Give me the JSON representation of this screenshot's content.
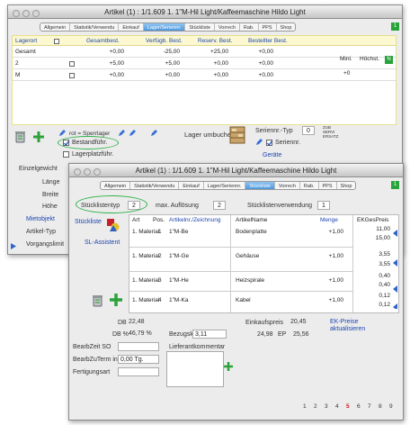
{
  "win1": {
    "title": "Artikel (1) : 1/1.609 1. 1\"M-Hil Light/Kaffeemaschine Hildo Light",
    "tabs": [
      "Allgemein",
      "Statistik/Verwendu",
      "Einkauf",
      "Lager/Seriennr.",
      "Stückliste",
      "Vorrech",
      "Rab.",
      "PPS",
      "Shop"
    ],
    "active_tab": 3,
    "badge": "1",
    "columns": [
      "Lagerort",
      "Gesamtbest.",
      "Verfügb. Best.",
      "Reserv. Best.",
      "Bestellter Best."
    ],
    "rows": [
      {
        "name": "Gesamt",
        "v1": "+0,00",
        "v2": "-25,00",
        "v3": "+25,00",
        "v4": "+0,00"
      },
      {
        "name": "2",
        "v1": "+5,00",
        "v2": "+5,00",
        "v3": "+0,00",
        "v4": "+0,00"
      },
      {
        "name": "M",
        "v1": "+0,00",
        "v2": "+0,00",
        "v3": "+0,00",
        "v4": "+0,00"
      }
    ],
    "extra_cols": [
      "Minl.",
      "Höchst."
    ],
    "badge_n": "N",
    "rot_sperrlager": "rot = Sperrlager",
    "bestandfuhr": "Bestandführ.",
    "lagerplatzfuhr": "Lagerplatzführ.",
    "lager_umbuchen": "Lager umbuchen",
    "seriennr_typ": "Seriennr.-Typ",
    "typ_value": "0",
    "serienn": "Seriennr.",
    "gerate": "Geräte",
    "tags": "ZUB SERVI ERSATZ",
    "side_labels": [
      "Einzelgewicht",
      "Länge",
      "Breite",
      "Höhe",
      "Mietobjekt",
      "Artikel-Typ",
      "Vorgangslimit"
    ]
  },
  "win2": {
    "title": "Artikel (1) : 1/1.609 1. 1\"M-Hil Light/Kaffeemaschine Hildo Light",
    "tabs": [
      "Allgemein",
      "Statistik/Verwendu",
      "Einkauf",
      "Lager/Seriennr.",
      "Stückliste",
      "Vorrech",
      "Rab.",
      "PPS",
      "Shop"
    ],
    "active_tab": 4,
    "badge": "1",
    "stucklistentyp": "Stücklistentyp",
    "typ_value": "2",
    "max_aufl": "max. Auflösung",
    "max_value": "2",
    "stucklistenverw": "Stücklistenverwendung",
    "verw_value": "1",
    "stuckliste": "Stückliste",
    "sl_assistent": "SL-Assistent",
    "columns": [
      "Art",
      "Pos.",
      "Artikelnr./Zeichnung",
      "ArtikelName",
      "Menge",
      "EKGesPreis"
    ],
    "rows": [
      {
        "art": "1. Material",
        "pos": "1",
        "nr": "1\"M-Be",
        "name": "Bodenplatte",
        "menge": "+1,00",
        "preis": "15,00"
      },
      {
        "art": "1. Material",
        "pos": "2",
        "nr": "1\"M-Ge",
        "name": "Gehäuse",
        "menge": "+1,00",
        "preis": "3,55"
      },
      {
        "art": "1. Material",
        "pos": "3",
        "nr": "1\"M-He",
        "name": "Heizspirale",
        "menge": "+1,00",
        "preis": "0,40"
      },
      {
        "art": "1. Material",
        "pos": "4",
        "nr": "1\"M-Ka",
        "name": "Kabel",
        "menge": "+1,00",
        "preis": "0,12"
      }
    ],
    "subtotals": [
      "11,00",
      "15,00",
      "3,55",
      "0,40",
      "0,12",
      "0,12"
    ],
    "db_label": "DB",
    "db_value": "22,48",
    "dbpct_label": "DB %",
    "dbpct_value": "46,79 %",
    "ek_label": "Einkaufspreis",
    "ek_value": "20,45",
    "ek_link": "EK-Preise aktualisieren",
    "bezug_label": "Bezugskosten",
    "bezug_value": "3,11",
    "p1": "24,98",
    "ep_label": "EP",
    "ep_value": "25,56",
    "bearb_label": "BearbZeit SO",
    "lief_label": "Lieferantkommentar",
    "bearbz_label": "BearbZuTerm in",
    "bearbz_value": "0,00 Tg.",
    "fert_label": "Fertigungsart",
    "pages": [
      "1",
      "2",
      "3",
      "4",
      "5",
      "6",
      "7",
      "8",
      "9"
    ],
    "active_page": 4
  },
  "colors": {
    "green": "#27a33a",
    "link": "#1e46b0",
    "active_tab": "#4f98dd",
    "page_active": "#d0111a"
  }
}
